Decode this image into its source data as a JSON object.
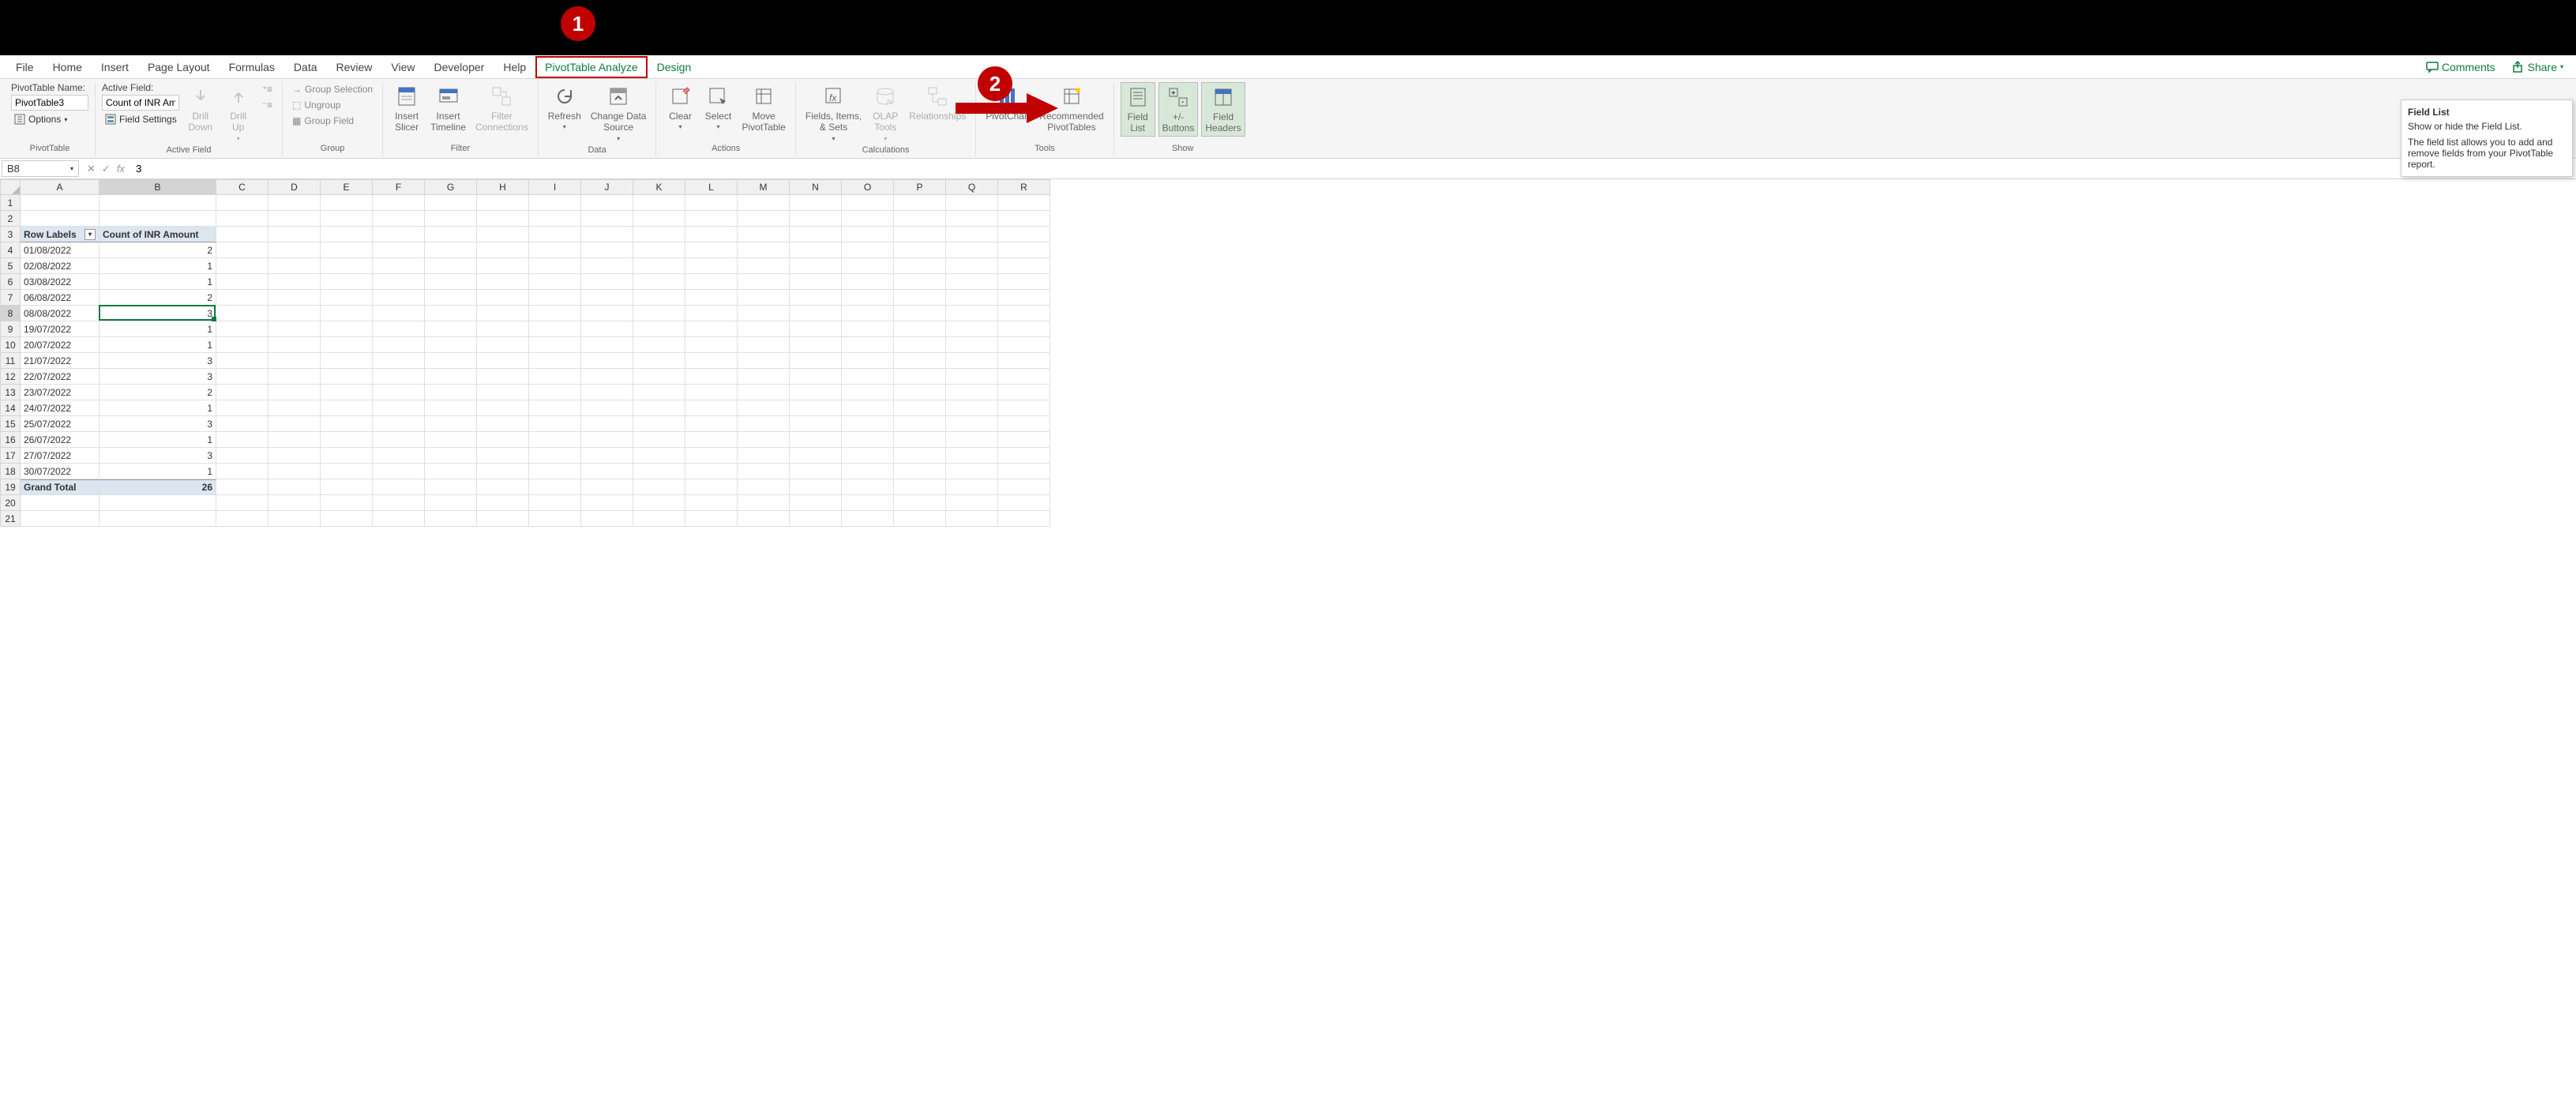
{
  "tabs": {
    "file": "File",
    "home": "Home",
    "insert": "Insert",
    "page_layout": "Page Layout",
    "formulas": "Formulas",
    "data": "Data",
    "review": "Review",
    "view": "View",
    "developer": "Developer",
    "help": "Help",
    "analyze": "PivotTable Analyze",
    "design": "Design"
  },
  "actions": {
    "comments": "Comments",
    "share": "Share"
  },
  "ribbon": {
    "pivottable": {
      "name_label": "PivotTable Name:",
      "name_value": "PivotTable3",
      "options": "Options",
      "group_label": "PivotTable"
    },
    "active_field": {
      "label": "Active Field:",
      "value": "Count of INR Amo",
      "field_settings": "Field Settings",
      "drill_down": "Drill\nDown",
      "drill_up": "Drill\nUp",
      "group_label": "Active Field"
    },
    "group": {
      "group_selection": "Group Selection",
      "ungroup": "Ungroup",
      "group_field": "Group Field",
      "group_label": "Group"
    },
    "filter": {
      "insert_slicer": "Insert\nSlicer",
      "insert_timeline": "Insert\nTimeline",
      "filter_connections": "Filter\nConnections",
      "group_label": "Filter"
    },
    "data": {
      "refresh": "Refresh",
      "change_source": "Change Data\nSource",
      "group_label": "Data"
    },
    "actions_grp": {
      "clear": "Clear",
      "select": "Select",
      "move": "Move\nPivotTable",
      "group_label": "Actions"
    },
    "calculations": {
      "fields_items": "Fields, Items,\n& Sets",
      "olap": "OLAP\nTools",
      "relationships": "Relationships",
      "group_label": "Calculations"
    },
    "tools": {
      "pivotchart": "PivotChart",
      "recommended": "Recommended\nPivotTables",
      "group_label": "Tools"
    },
    "show": {
      "field_list": "Field\nList",
      "buttons": "+/-\nButtons",
      "headers": "Field\nHeaders",
      "group_label": "Show"
    }
  },
  "formula_bar": {
    "name_box": "B8",
    "value": "3"
  },
  "columns": [
    "A",
    "B",
    "C",
    "D",
    "E",
    "F",
    "G",
    "H",
    "I",
    "J",
    "K",
    "L",
    "M",
    "N",
    "O",
    "P",
    "Q",
    "R"
  ],
  "col_widths": {
    "A": 100,
    "B": 148,
    "default": 66
  },
  "selected_cell": {
    "row": 8,
    "col": "B"
  },
  "grid": {
    "header_row": 3,
    "headers": {
      "A": "Row Labels",
      "B": "Count of INR Amount"
    },
    "rows": [
      {
        "r": 4,
        "A": "01/08/2022",
        "B": "2"
      },
      {
        "r": 5,
        "A": "02/08/2022",
        "B": "1"
      },
      {
        "r": 6,
        "A": "03/08/2022",
        "B": "1"
      },
      {
        "r": 7,
        "A": "06/08/2022",
        "B": "2"
      },
      {
        "r": 8,
        "A": "08/08/2022",
        "B": "3"
      },
      {
        "r": 9,
        "A": "19/07/2022",
        "B": "1"
      },
      {
        "r": 10,
        "A": "20/07/2022",
        "B": "1"
      },
      {
        "r": 11,
        "A": "21/07/2022",
        "B": "3"
      },
      {
        "r": 12,
        "A": "22/07/2022",
        "B": "3"
      },
      {
        "r": 13,
        "A": "23/07/2022",
        "B": "2"
      },
      {
        "r": 14,
        "A": "24/07/2022",
        "B": "1"
      },
      {
        "r": 15,
        "A": "25/07/2022",
        "B": "3"
      },
      {
        "r": 16,
        "A": "26/07/2022",
        "B": "1"
      },
      {
        "r": 17,
        "A": "27/07/2022",
        "B": "3"
      },
      {
        "r": 18,
        "A": "30/07/2022",
        "B": "1"
      }
    ],
    "total_row": {
      "r": 19,
      "A": "Grand Total",
      "B": "26"
    },
    "max_row": 21
  },
  "tooltip": {
    "title": "Field List",
    "line1": "Show or hide the Field List.",
    "line2": "The field list allows you to add and remove fields from your PivotTable report."
  },
  "annotations": {
    "one": "1",
    "two": "2"
  }
}
